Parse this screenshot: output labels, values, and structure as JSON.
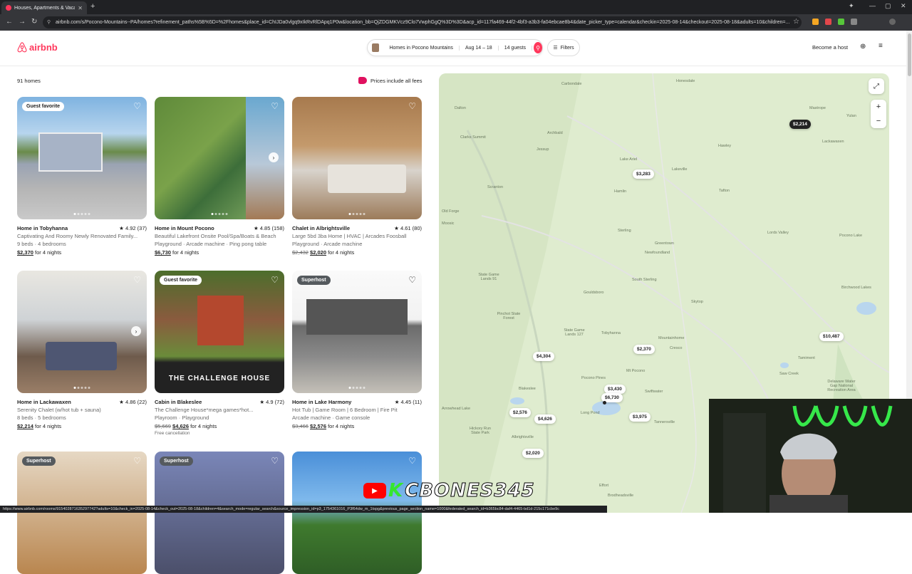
{
  "browser": {
    "tab_title": "Houses, Apartments & Vacation...",
    "url": "airbnb.com/s/Pocono-Mountains--PA/homes?refinement_paths%5B%5D=%2Fhomes&place_id=ChIJDa0vlgq9xIkRvRlDApq1P0w&location_bb=QjZDGMKVcz9Clo7VwphGgQ%3D%3D&acp_id=117fa469-44f2-4bf3-a3b3-fa04ebcae8b4&date_picker_type=calendar&checkin=2025-08-14&checkout=2025-08-18&adults=10&children=...",
    "status_url": "https://www.airbnb.com/rooms/915402871635297742?adults=10&check_in=2025-08-14&check_out=2025-08-18&children=4&search_mode=regular_search&source_impression_id=p3_1754361016_P3f64dw_m_1tspg&previous_page_section_name=1000&federated_search_id=b365bc84-daf4-4465-bd1d-215c171cbe9c"
  },
  "header": {
    "logo_text": "airbnb",
    "search_location": "Homes in Pocono Mountains",
    "search_dates": "Aug 14 – 18",
    "search_guests": "14 guests",
    "filters_label": "Filters",
    "become_host": "Become a host"
  },
  "results": {
    "count": "91 homes",
    "prices_note": "Prices include all fees"
  },
  "listings": [
    {
      "badge": "Guest favorite",
      "title": "Home in Tobyhanna",
      "rating": "4.92 (37)",
      "desc": "Captivating And Roomy Newly Renovated Family...",
      "details": "9 beds · 4 bedrooms",
      "old_price": "",
      "price": "$2,370",
      "nights": "for 4 nights",
      "extra": ""
    },
    {
      "badge": "",
      "title": "Home in Mount Pocono",
      "rating": "4.85 (158)",
      "desc": "Beautiful Lakefront Onsite Pool/Spa/Boats & Beach",
      "details": "Playground · Arcade machine · Ping pong table",
      "old_price": "",
      "price": "$6,730",
      "nights": "for 4 nights",
      "extra": ""
    },
    {
      "badge": "",
      "title": "Chalet in Albrightsville",
      "rating": "4.61 (80)",
      "desc": "Large 5bd 3ba Home | HVAC | Arcades Foosball",
      "details": "Playground · Arcade machine",
      "old_price": "$2,432",
      "price": "$2,020",
      "nights": "for 4 nights",
      "extra": ""
    },
    {
      "badge": "",
      "title": "Home in Lackawaxen",
      "rating": "4.86 (22)",
      "desc": "Serenity Chalet (w/hot tub + sauna)",
      "details": "8 beds · 5 bedrooms",
      "old_price": "",
      "price": "$2,214",
      "nights": "for 4 nights",
      "extra": ""
    },
    {
      "badge": "Guest favorite",
      "title": "Cabin in Blakeslee",
      "rating": "4.9 (72)",
      "desc": "The Challenge House*mega games*hot...",
      "details": "Playroom · Playground",
      "old_price": "$5,669",
      "price": "$4,626",
      "nights": "for 4 nights",
      "extra": "Free cancellation"
    },
    {
      "badge": "Superhost",
      "title": "Home in Lake Harmony",
      "rating": "4.45 (11)",
      "desc": "Hot Tub | Game Room | 6 Bedroom | Fire Pit",
      "details": "Arcade machine · Game console",
      "old_price": "$3,466",
      "price": "$2,576",
      "nights": "for 4 nights",
      "extra": ""
    },
    {
      "badge": "Superhost"
    },
    {
      "badge": "Superhost"
    },
    {
      "badge": ""
    }
  ],
  "challenge_sign": "THE CHALLENGE HOUSE",
  "map": {
    "towns": [
      "Carbondale",
      "Honesdale",
      "Dalton",
      "Clarks Summit",
      "Archbald",
      "Jessup",
      "Mastrope",
      "Yulan",
      "Lackawaxen",
      "Lake Ariel",
      "Hawley",
      "Lakeville",
      "Scranton",
      "Hamlin",
      "Tafton",
      "Old Forge",
      "Moosic",
      "Sterling",
      "Lords Valley",
      "Greentown",
      "Newfoundland",
      "Pocono Lake",
      "South Sterling",
      "Gouldsboro",
      "Birchwood Lakes",
      "Skytop",
      "Tobyhanna",
      "Mountainhome",
      "Cresco",
      "Tamiment",
      "Mt Pocono",
      "Pocono Pines",
      "Blakeslee",
      "Long Pond",
      "Swiftwater",
      "Saw Creek",
      "Tannersville",
      "Albrightsville",
      "Effort",
      "Brodheadsville",
      "Delaware Water Gap National Recreation Area",
      "State Game Lands 91",
      "Pinchot State Forest",
      "State Game Lands 127",
      "Hickory Run State Park",
      "Arrowhead Lake"
    ],
    "pins": [
      "$2,214",
      "$3,283",
      "$10,487",
      "$2,370",
      "$4,304",
      "$3,430",
      "$6,730",
      "$2,576",
      "$4,626",
      "$3,975",
      "$2,020"
    ],
    "active_pin": "$2,214"
  },
  "overlay": {
    "channel_k": "K",
    "channel_name": "CBONES345"
  },
  "colors": {
    "brand": "#ff385c",
    "map_bg": "#dfeccf"
  }
}
